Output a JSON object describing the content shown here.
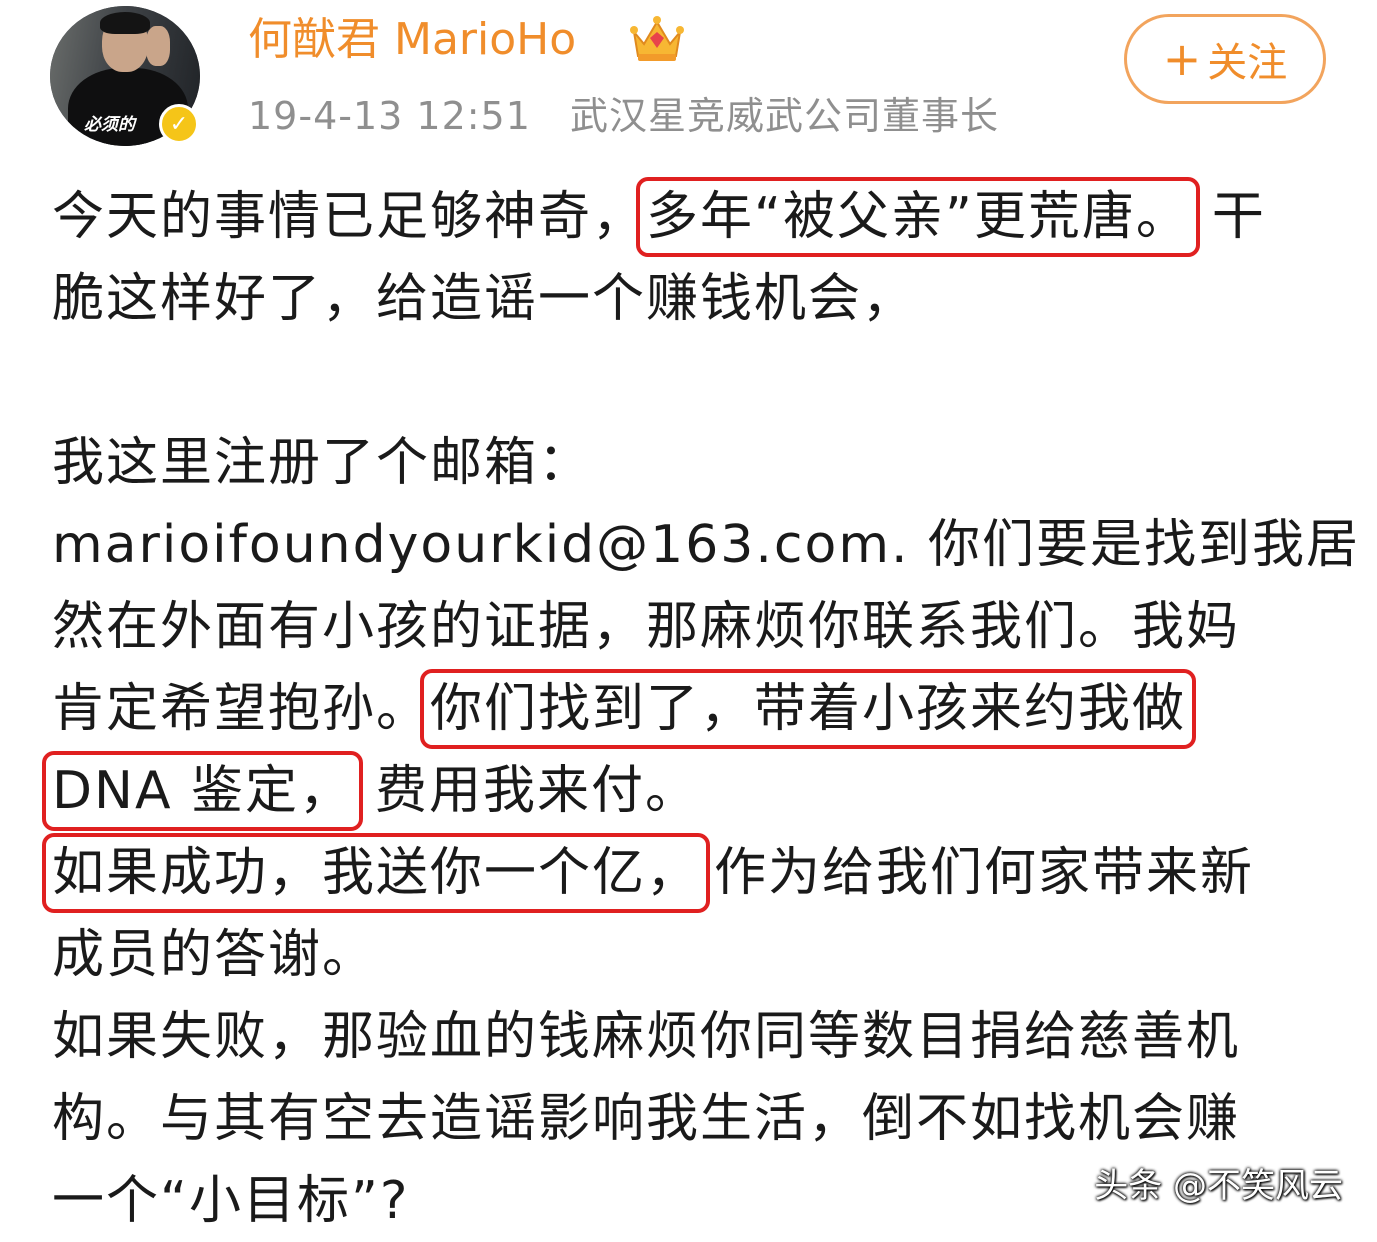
{
  "header": {
    "username": "何猷君 MarioHo",
    "time": "19-4-13 12:51",
    "title": "武汉星竞威武公司董事长",
    "follow_plus": "+",
    "follow_label": "关注",
    "avatar_caption": "必须的"
  },
  "post": {
    "l1_a": "今天的事情已足够神奇，",
    "l1_hl": "多年“被父亲”更荒唐。",
    "l1_b": "干",
    "l2": "脆这样好了，给造谣一个赚钱机会，",
    "l3": "我这里注册了个邮箱：",
    "l4": "marioifoundyourkid@163.com. 你们要是找到我居",
    "l5": "然在外面有小孩的证据，那麻烦你联系我们。我妈",
    "l6_a": "肯定希望抱孙。",
    "l6_hl": "你们找到了，带着小孩来约我做",
    "l7_hl": "DNA 鉴定，",
    "l7_b": "费用我来付。",
    "l8_hl": "如果成功，我送你一个亿，",
    "l8_b": "作为给我们何家带来新",
    "l9": "成员的答谢。",
    "l10": "如果失败，那验血的钱麻烦你同等数目捐给慈善机",
    "l11": "构。与其有空去造谣影响我生活，倒不如找机会赚",
    "l12": "一个“小目标”?"
  },
  "watermark": "头条 @不笑风云",
  "colors": {
    "username": "#f08d2b",
    "highlight_box": "#e02020",
    "verified_badge": "#f5c518",
    "meta_text": "#8f8f8f"
  },
  "icons": [
    "crown-icon",
    "verified-badge-icon",
    "plus-icon"
  ]
}
